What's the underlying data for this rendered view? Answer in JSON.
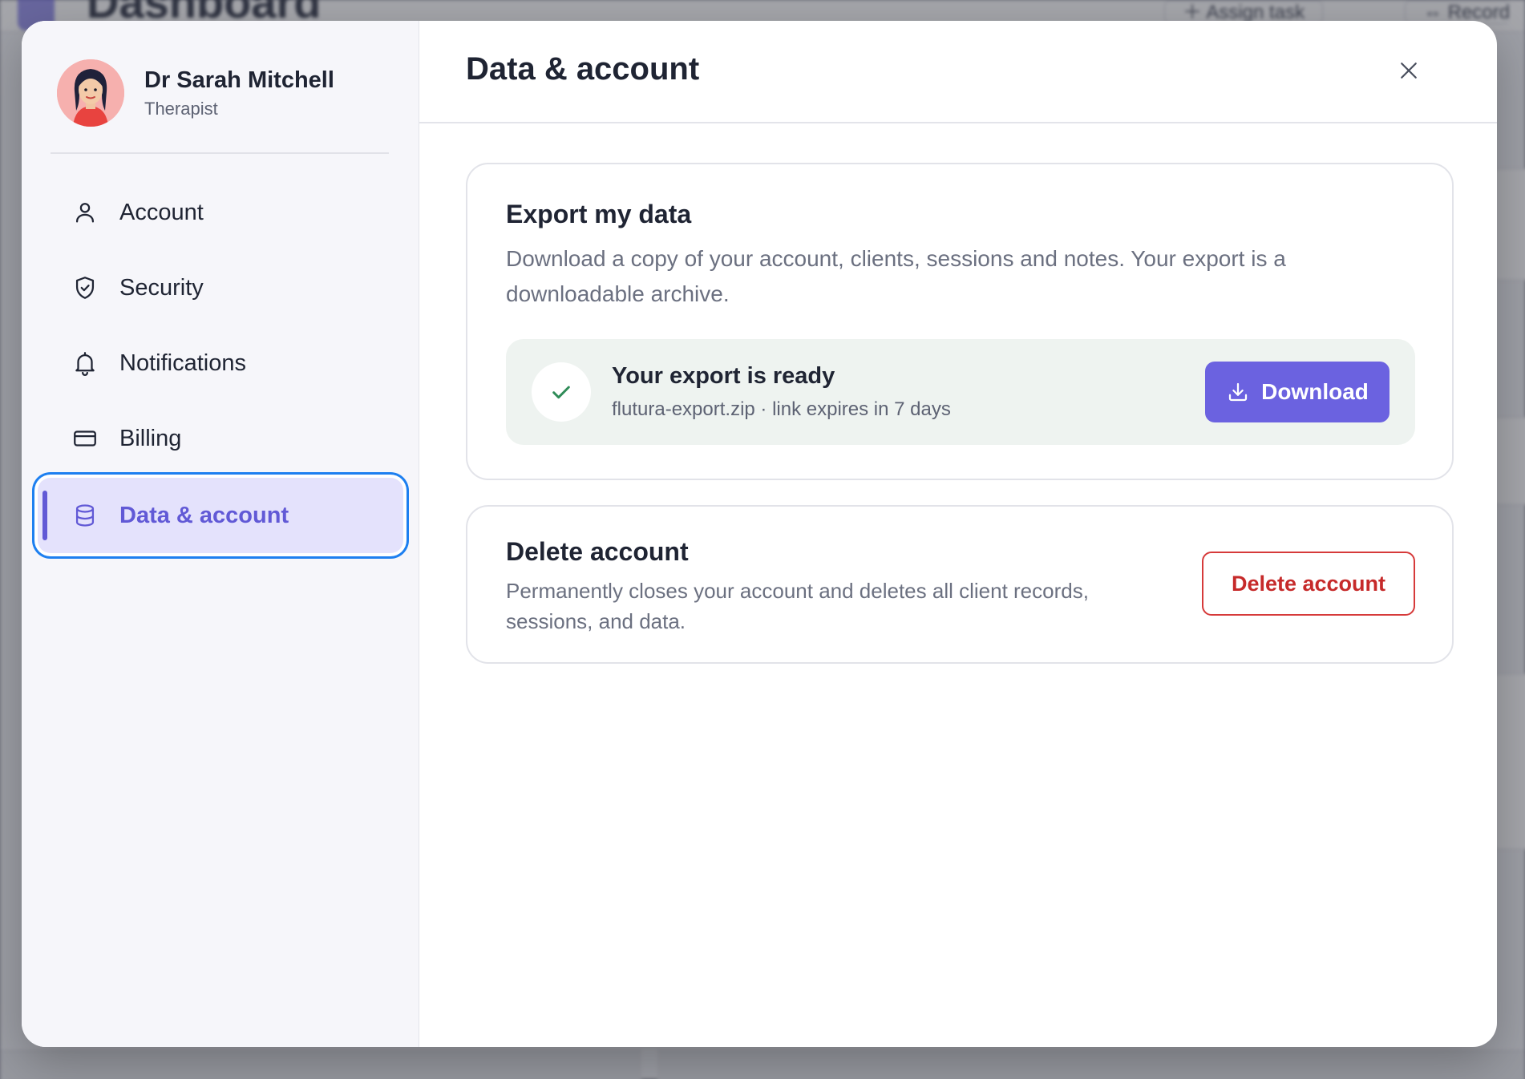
{
  "background": {
    "title": "Dashboard",
    "buttons": [
      "Assign task",
      "Record"
    ]
  },
  "profile": {
    "name": "Dr Sarah Mitchell",
    "role": "Therapist"
  },
  "sidebar": {
    "items": [
      {
        "label": "Account",
        "icon": "user-icon"
      },
      {
        "label": "Security",
        "icon": "shield-check-icon"
      },
      {
        "label": "Notifications",
        "icon": "bell-icon"
      },
      {
        "label": "Billing",
        "icon": "credit-card-icon"
      },
      {
        "label": "Data & account",
        "icon": "database-icon",
        "active": true
      }
    ]
  },
  "main": {
    "title": "Data & account"
  },
  "export": {
    "title": "Export my data",
    "description": "Download a copy of your account, clients, sessions and notes. Your export is a downloadable archive.",
    "status_title": "Your export is ready",
    "status_detail": "flutura-export.zip · link expires in 7 days",
    "download_label": "Download"
  },
  "delete": {
    "title": "Delete account",
    "description": "Permanently closes your account and deletes all client records, sessions, and data.",
    "button_label": "Delete account"
  },
  "colors": {
    "accent": "#6B62E0",
    "active_bg": "#E4E2FC",
    "focus_ring": "#1D7FF0",
    "danger": "#C62A2A",
    "success": "#2E8B57",
    "ready_bg": "#EEF3F0"
  }
}
